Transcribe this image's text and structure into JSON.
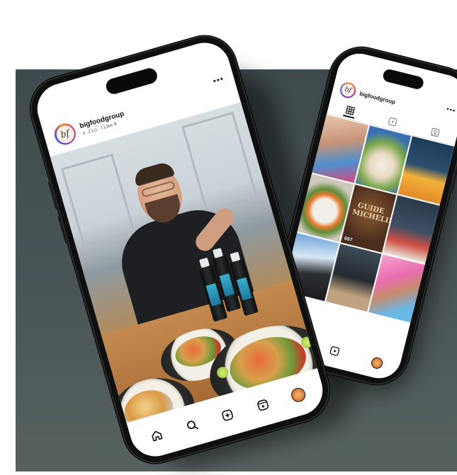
{
  "feed_post": {
    "username": "bigfoodgroup",
    "song": "♬ J.Lo · I Like It",
    "more_label": "•••"
  },
  "nav": {
    "icons": [
      "home-icon",
      "search-icon",
      "create-icon",
      "reels-icon",
      "profile-avatar"
    ]
  },
  "profile": {
    "username": "bigfoodgroup",
    "more_label": "•••",
    "tabs": [
      "grid-tab-icon",
      "reels-tab-icon",
      "tagged-tab-icon"
    ],
    "tiles": [
      {
        "count": ""
      },
      {
        "count": ""
      },
      {
        "count": ""
      },
      {
        "count": ""
      },
      {
        "count": "697",
        "title": "GUIDE MICHELIN"
      },
      {
        "count": ""
      },
      {
        "count": ""
      },
      {
        "count": ""
      },
      {
        "count": ""
      }
    ]
  },
  "colors": {
    "backdrop": "#4a5558",
    "phone_frame": "#0f0f10",
    "screen": "#ffffff",
    "avatar_ring": "#dd2a7b"
  }
}
